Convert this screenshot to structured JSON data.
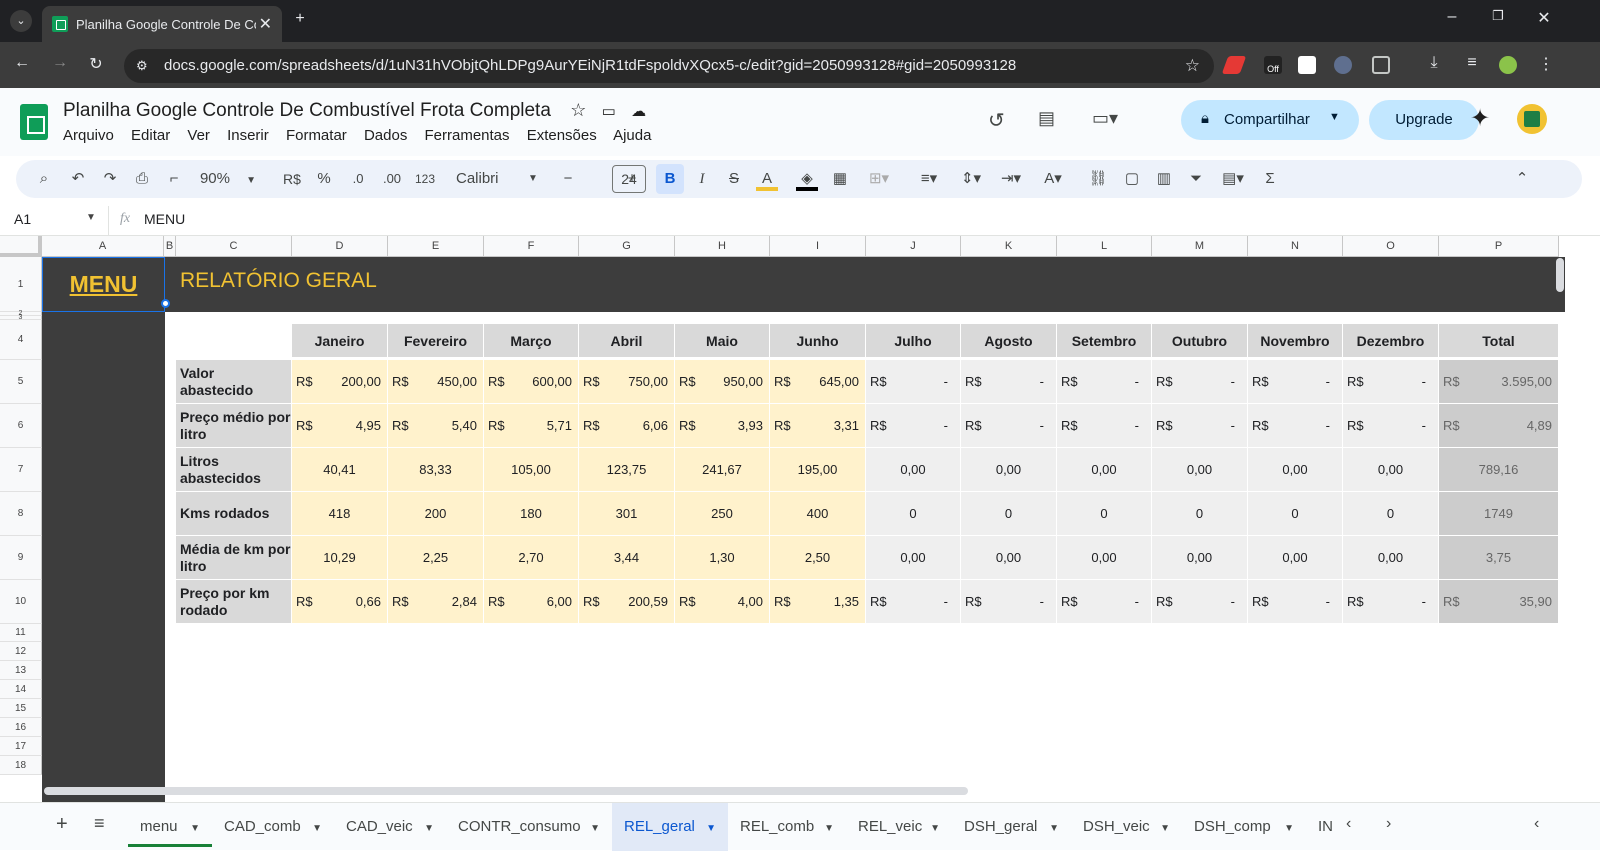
{
  "browser": {
    "tab_title": "Planilha Google Controle De Co",
    "url": "docs.google.com/spreadsheets/d/1uN31hVObjtQhLDPg9AurYEiNjR1tdFspoldvXQcx5-c/edit?gid=2050993128#gid=2050993128",
    "new_tab": "+",
    "close": "✕",
    "ext_off": "Off"
  },
  "doc": {
    "title": "Planilha Google Controle De Combustível Frota Completa",
    "menu": [
      "Arquivo",
      "Editar",
      "Ver",
      "Inserir",
      "Formatar",
      "Dados",
      "Ferramentas",
      "Extensões",
      "Ajuda"
    ],
    "share_label": "Compartilhar",
    "upgrade_label": "Upgrade"
  },
  "toolbar": {
    "zoom": "90%",
    "currency": "R$",
    "percent": "%",
    "dec_less": ".0",
    "dec_more": ".00",
    "format_123": "123",
    "font": "Calibri",
    "font_size": "24",
    "bold": "B",
    "italic": "I",
    "strike": "S",
    "text_color": "A"
  },
  "formula_bar": {
    "cell_ref": "A1",
    "fx": "fx",
    "value": "MENU"
  },
  "grid": {
    "columns": [
      "A",
      "B",
      "C",
      "D",
      "E",
      "F",
      "G",
      "H",
      "I",
      "J",
      "K",
      "L",
      "M",
      "N",
      "O",
      "P"
    ],
    "rows": [
      "1",
      "2",
      "3",
      "4",
      "5",
      "6",
      "7",
      "8",
      "9",
      "10",
      "11",
      "12",
      "13",
      "14",
      "15",
      "16",
      "17",
      "18"
    ],
    "menu_label": "MENU",
    "report_title": "RELATÓRIO GERAL",
    "months": [
      "Janeiro",
      "Fevereiro",
      "Março",
      "Abril",
      "Maio",
      "Junho",
      "Julho",
      "Agosto",
      "Setembro",
      "Outubro",
      "Novembro",
      "Dezembro",
      "Total"
    ],
    "table_rows": [
      {
        "label": "Valor abastecido",
        "currency": true,
        "values": [
          "200,00",
          "450,00",
          "600,00",
          "750,00",
          "950,00",
          "645,00",
          "-",
          "-",
          "-",
          "-",
          "-",
          "-",
          "3.595,00"
        ]
      },
      {
        "label": "Preço médio por litro",
        "currency": true,
        "values": [
          "4,95",
          "5,40",
          "5,71",
          "6,06",
          "3,93",
          "3,31",
          "-",
          "-",
          "-",
          "-",
          "-",
          "-",
          "4,89"
        ]
      },
      {
        "label": "Litros abastecidos",
        "currency": false,
        "values": [
          "40,41",
          "83,33",
          "105,00",
          "123,75",
          "241,67",
          "195,00",
          "0,00",
          "0,00",
          "0,00",
          "0,00",
          "0,00",
          "0,00",
          "789,16"
        ]
      },
      {
        "label": "Kms rodados",
        "currency": false,
        "values": [
          "418",
          "200",
          "180",
          "301",
          "250",
          "400",
          "0",
          "0",
          "0",
          "0",
          "0",
          "0",
          "1749"
        ]
      },
      {
        "label": "Média de km por litro",
        "currency": false,
        "values": [
          "10,29",
          "2,25",
          "2,70",
          "3,44",
          "1,30",
          "2,50",
          "0,00",
          "0,00",
          "0,00",
          "0,00",
          "0,00",
          "0,00",
          "3,75"
        ]
      },
      {
        "label": "Preço por km rodado",
        "currency": true,
        "values": [
          "0,66",
          "2,84",
          "6,00",
          "200,59",
          "4,00",
          "1,35",
          "-",
          "-",
          "-",
          "-",
          "-",
          "-",
          "35,90"
        ]
      }
    ],
    "currency_symbol": "R$"
  },
  "sheets": {
    "tabs": [
      "menu",
      "CAD_comb",
      "CAD_veic",
      "CONTR_consumo",
      "REL_geral",
      "REL_comb",
      "REL_veic",
      "DSH_geral",
      "DSH_veic",
      "DSH_comp",
      "IN"
    ],
    "active": "REL_geral"
  },
  "colors": {
    "dark_panel": "#3d3d3d",
    "gold": "#f1c232",
    "yellow_fill": "#fff2cc",
    "gray_fill": "#efefef",
    "header_fill": "#d9d9d9",
    "accent_blue": "#0b57d0"
  }
}
